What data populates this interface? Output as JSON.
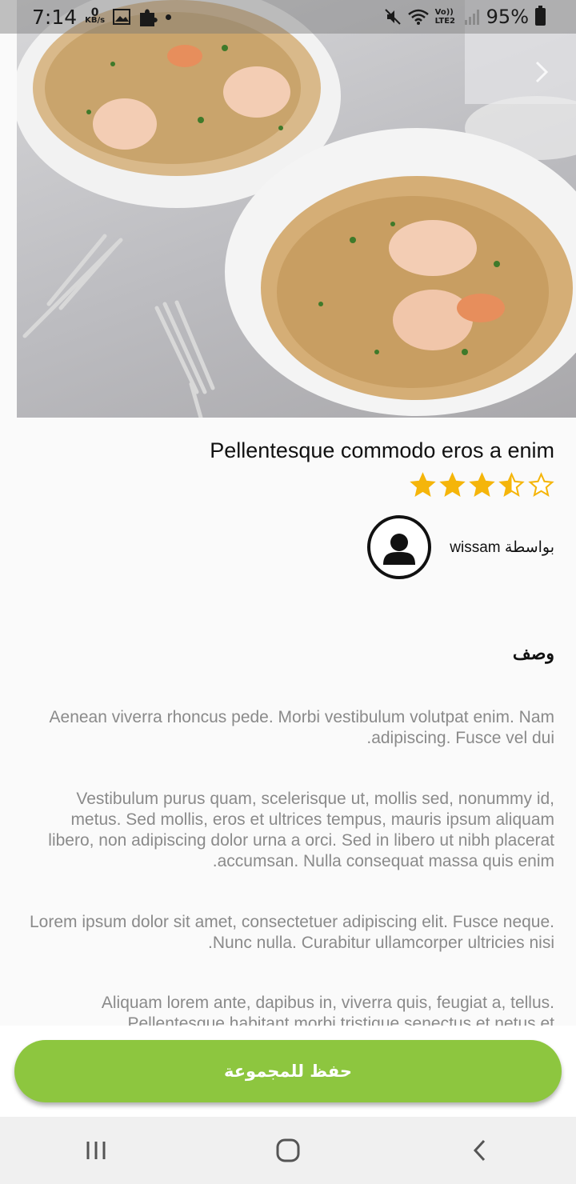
{
  "status_bar": {
    "time": "7:14",
    "net_speed_value": "0",
    "net_speed_unit": "KB/s",
    "network_label": "Vo)) LTE2",
    "battery": "95%"
  },
  "recipe": {
    "title": "Pellentesque commodo eros a enim",
    "rating": 3.5,
    "rating_max": 5,
    "author_label": "بواسطة wissam"
  },
  "description": {
    "heading": "وصف",
    "paragraphs": [
      "Aenean viverra rhoncus pede. Morbi vestibulum volutpat enim. Nam adipiscing. Fusce vel dui.",
      "Vestibulum purus quam, scelerisque ut, mollis sed, nonummy id, metus. Sed mollis, eros et ultrices tempus, mauris ipsum aliquam libero, non adipiscing dolor urna a orci. Sed in libero ut nibh placerat accumsan. Nulla consequat massa quis enim.",
      "Lorem ipsum dolor sit amet, consectetuer adipiscing elit. Fusce neque. Nunc nulla. Curabitur ullamcorper ultricies nisi.",
      "Aliquam lorem ante, dapibus in, viverra quis, feugiat a, tellus. Pellentesque habitant morbi tristique senectus et netus et"
    ]
  },
  "actions": {
    "save_label": "حفظ للمجموعة"
  },
  "colors": {
    "accent": "#8dc63f",
    "star": "#f5b50a"
  },
  "icons": {
    "hero_next": "chevron-right-icon",
    "avatar": "user-circle-icon",
    "nav_recent": "recent-apps-icon",
    "nav_home": "home-icon",
    "nav_back": "back-icon"
  }
}
